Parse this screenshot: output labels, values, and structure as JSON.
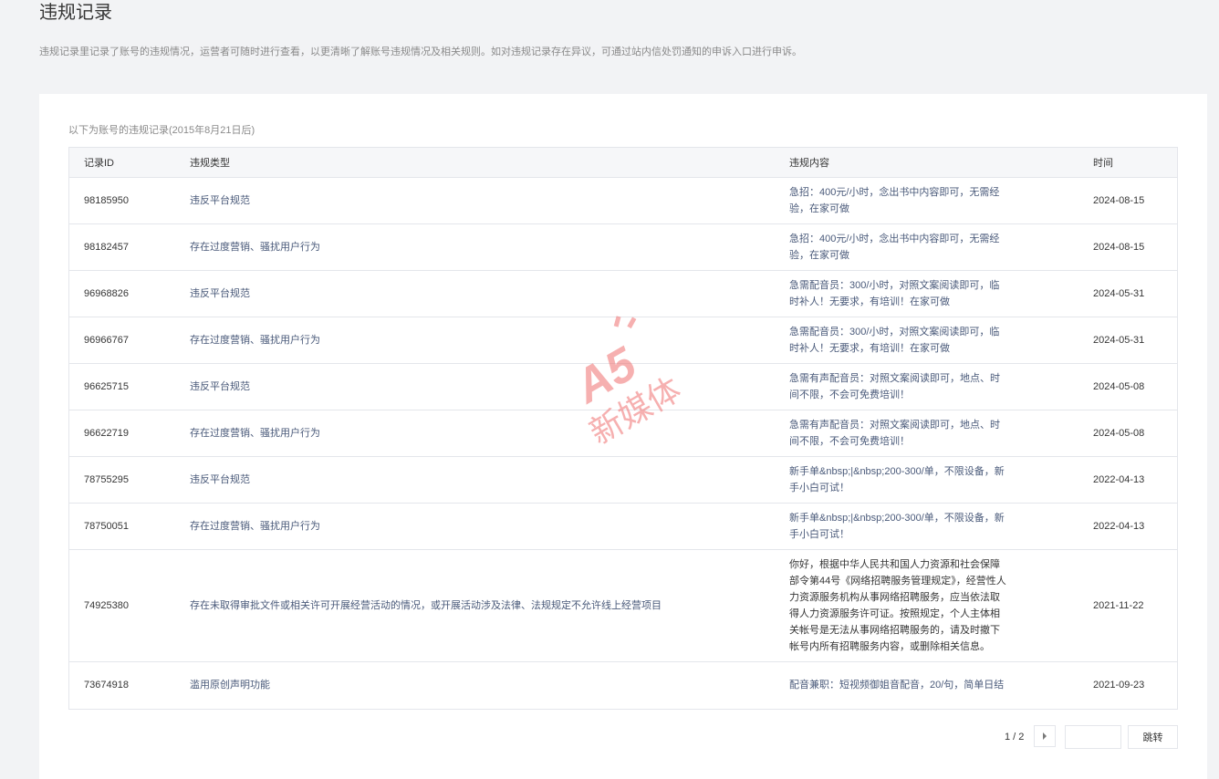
{
  "page": {
    "title": "违规记录",
    "description": "违规记录里记录了账号的违规情况，运营者可随时进行查看，以更清晰了解账号违规情况及相关规则。如对违规记录存在异议，可通过站内信处罚通知的申诉入口进行申诉。"
  },
  "table": {
    "caption": "以下为账号的违规记录(2015年8月21日后)",
    "headers": [
      "记录ID",
      "违规类型",
      "违规内容",
      "时间"
    ],
    "rows": [
      {
        "id": "98185950",
        "type": "违反平台规范",
        "content": "急招：400元/小时，念出书中内容即可，无需经验，在家可做",
        "time": "2024-08-15"
      },
      {
        "id": "98182457",
        "type": "存在过度营销、骚扰用户行为",
        "content": "急招：400元/小时，念出书中内容即可，无需经验，在家可做",
        "time": "2024-08-15"
      },
      {
        "id": "96968826",
        "type": "违反平台规范",
        "content": "急需配音员：300/小时，对照文案阅读即可，临时补人！无要求，有培训！在家可做",
        "time": "2024-05-31"
      },
      {
        "id": "96966767",
        "type": "存在过度营销、骚扰用户行为",
        "content": "急需配音员：300/小时，对照文案阅读即可，临时补人！无要求，有培训！在家可做",
        "time": "2024-05-31"
      },
      {
        "id": "96625715",
        "type": "违反平台规范",
        "content": "急需有声配音员：对照文案阅读即可，地点、时间不限，不会可免费培训！",
        "time": "2024-05-08"
      },
      {
        "id": "96622719",
        "type": "存在过度营销、骚扰用户行为",
        "content": "急需有声配音员：对照文案阅读即可，地点、时间不限，不会可免费培训！",
        "time": "2024-05-08"
      },
      {
        "id": "78755295",
        "type": "违反平台规范",
        "content": "新手单&nbsp;|&nbsp;200-300/单，不限设备，新手小白可试！",
        "time": "2022-04-13"
      },
      {
        "id": "78750051",
        "type": "存在过度营销、骚扰用户行为",
        "content": "新手单&nbsp;|&nbsp;200-300/单，不限设备，新手小白可试！",
        "time": "2022-04-13"
      },
      {
        "id": "74925380",
        "type": "存在未取得审批文件或相关许可开展经营活动的情况，或开展活动涉及法律、法规规定不允许线上经营项目",
        "content": "你好，根据中华人民共和国人力资源和社会保障部令第44号《网络招聘服务管理规定》，经营性人力资源服务机构从事网络招聘服务，应当依法取得人力资源服务许可证。按照规定，个人主体相关帐号是无法从事网络招聘服务的，请及时撤下帐号内所有招聘服务内容，或删除相关信息。",
        "time": "2021-11-22"
      },
      {
        "id": "73674918",
        "type": "滥用原创声明功能",
        "content": "配音兼职：短视频御姐音配音，20/句，简单日结",
        "time": "2021-09-23"
      }
    ]
  },
  "pagination": {
    "count": "1 / 2",
    "next_icon": "chevron-right-icon",
    "jump_input_value": "",
    "jump_label": "跳转"
  },
  "watermark": {
    "logo_text": "A5",
    "text": "新媒体",
    "color": "#f07070"
  }
}
